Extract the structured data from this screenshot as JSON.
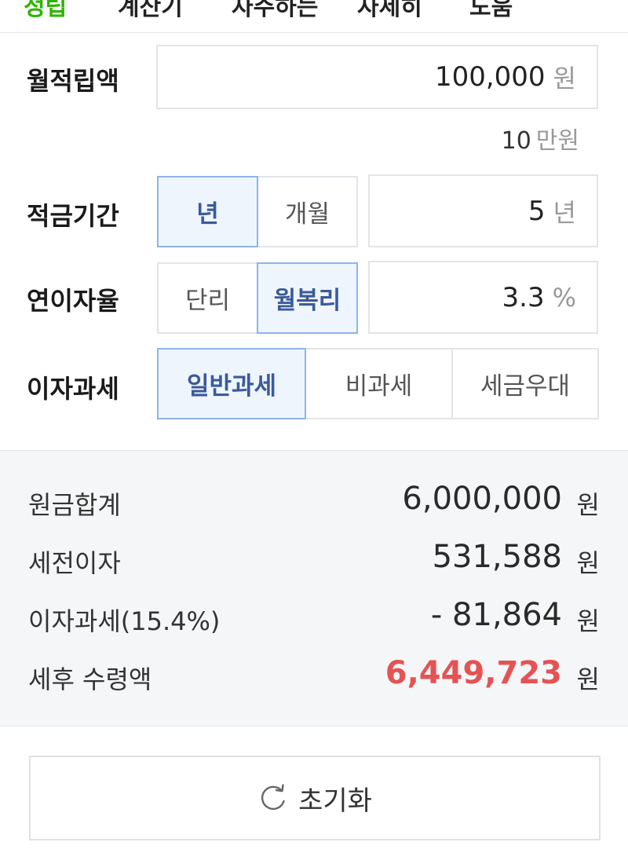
{
  "top_tabs": [
    {
      "label": "정립",
      "active": true
    },
    {
      "label": "계산기"
    },
    {
      "label": "자주하는"
    },
    {
      "label": "자세히"
    },
    {
      "label": "도움"
    }
  ],
  "monthly_deposit": {
    "label": "월적립액",
    "value": "100,000",
    "unit": "원",
    "helper_value": "10",
    "helper_unit": "만원"
  },
  "savings_period": {
    "label": "적금기간",
    "options": [
      "년",
      "개월"
    ],
    "selected": "년",
    "value": "5",
    "unit": "년"
  },
  "interest_rate": {
    "label": "연이자율",
    "options": [
      "단리",
      "월복리"
    ],
    "selected": "월복리",
    "value": "3.3",
    "unit": "%"
  },
  "interest_tax": {
    "label": "이자과세",
    "options": [
      "일반과세",
      "비과세",
      "세금우대"
    ],
    "selected": "일반과세"
  },
  "summary": {
    "rows": [
      {
        "label": "원금합계",
        "value": "6,000,000",
        "unit": "원"
      },
      {
        "label": "세전이자",
        "value": "531,588",
        "unit": "원"
      },
      {
        "label": "이자과세(15.4%)",
        "value": "- 81,864",
        "unit": "원"
      },
      {
        "label": "세후 수령액",
        "value": "6,449,723",
        "unit": "원"
      }
    ],
    "highlight_color": "#e45353"
  },
  "reset": {
    "label": "초기화",
    "icon": "refresh-icon"
  },
  "colors": {
    "accent_green": "#2db400",
    "selected_bg": "#eef5fd",
    "selected_border": "#8fb4e8",
    "selected_text": "#3c5a99"
  }
}
